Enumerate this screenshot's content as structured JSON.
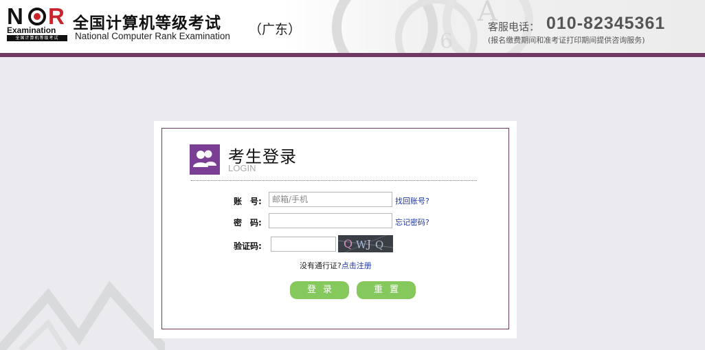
{
  "header": {
    "logo_text": "NCR",
    "logo_word": "Examination",
    "logo_sub": "全国计算机等级考试",
    "title": "全国计算机等级考试",
    "subtitle": "National Computer Rank Examination",
    "region": "（广东）",
    "phone_label": "客服电话：",
    "phone_number": "010-82345361",
    "phone_note": "(报名缴费期间和准考证打印期间提供咨询服务)"
  },
  "login": {
    "title": "考生登录",
    "subtitle": "LOGIN",
    "account_label": "账　号:",
    "account_placeholder": "邮箱/手机",
    "account_value": "",
    "find_account_link": "找回账号?",
    "password_label": "密　码:",
    "password_value": "",
    "forgot_password_link": "忘记密码?",
    "captcha_label": "验证码:",
    "captcha_value": "",
    "captcha_text": "QWJQ",
    "register_prompt": "没有通行证?",
    "register_link": "点击注册",
    "login_button": "登录",
    "reset_button": "重置"
  },
  "colors": {
    "accent_purple": "#6f3a63",
    "icon_purple": "#7a3f94",
    "button_green": "#85c85c",
    "link_blue": "#1a35a8"
  },
  "icons": {
    "login_icon": "users-icon"
  }
}
